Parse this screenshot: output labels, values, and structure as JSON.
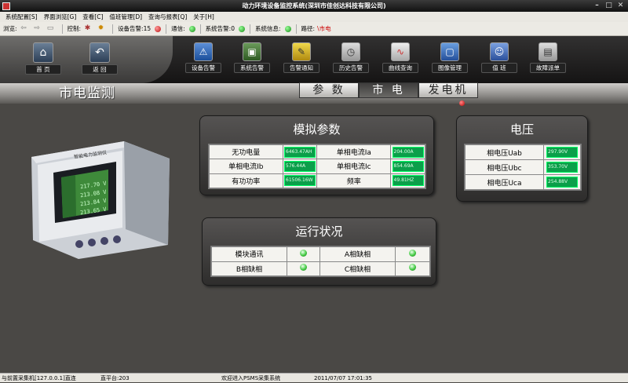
{
  "window": {
    "title": "动力环境设备监控系统(深圳市佳创达科技有限公司)"
  },
  "menu": [
    "系统配置[S]",
    "界面浏览[G]",
    "查看[C]",
    "值班管理[D]",
    "查询与报表[Q]",
    "关于[H]"
  ],
  "toolbar": {
    "browse_label": "浏览:",
    "control_label": "控制:",
    "device_alarm": "设备告警:15",
    "comm": "通信:",
    "sys_alarm": "系统告警:0",
    "sys_info": "系统信息:",
    "path_label": "路径:",
    "path_value": "\\市电"
  },
  "nav": {
    "home": "首 页",
    "back": "返 回",
    "items": [
      "设备告警",
      "系统告警",
      "告警通知",
      "历史告警",
      "曲线查询",
      "图像管理",
      "值 班",
      "故障派单"
    ]
  },
  "page": {
    "title": "市电监测"
  },
  "tabs": [
    "参 数",
    "市 电",
    "发电机"
  ],
  "analog": {
    "title": "模拟参数",
    "rows": [
      {
        "l1": "无功电量",
        "v1": "6463.47AH",
        "l2": "单相电流Ia",
        "v2": "204.00A"
      },
      {
        "l1": "单相电流Ib",
        "v1": "576.44A",
        "l2": "单相电流Ic",
        "v2": "854.69A"
      },
      {
        "l1": "有功功率",
        "v1": "61506.16W",
        "l2": "频率",
        "v2": "49.81HZ"
      }
    ]
  },
  "voltage": {
    "title": "电压",
    "rows": [
      {
        "label": "相电压Uab",
        "value": "297.90V"
      },
      {
        "label": "相电压Ubc",
        "value": "353.70V"
      },
      {
        "label": "相电压Uca",
        "value": "254.88V"
      }
    ]
  },
  "status": {
    "title": "运行状况",
    "rows": [
      {
        "l1": "模块通讯",
        "l2": "A相缺相"
      },
      {
        "l1": "B相缺相",
        "l2": "C相缺相"
      }
    ]
  },
  "device": {
    "name": "智能电力监测仪",
    "readings": [
      "217.70 V",
      "213.08 V",
      "213.84 V",
      "213.65 V"
    ]
  },
  "statusbar": {
    "conn": "与前置采集机[127.0.0.1]直连",
    "platform": "直平台:203",
    "welcome": "欢迎进入PSMS采集系统",
    "time": "2011/07/07 17:01:35"
  }
}
